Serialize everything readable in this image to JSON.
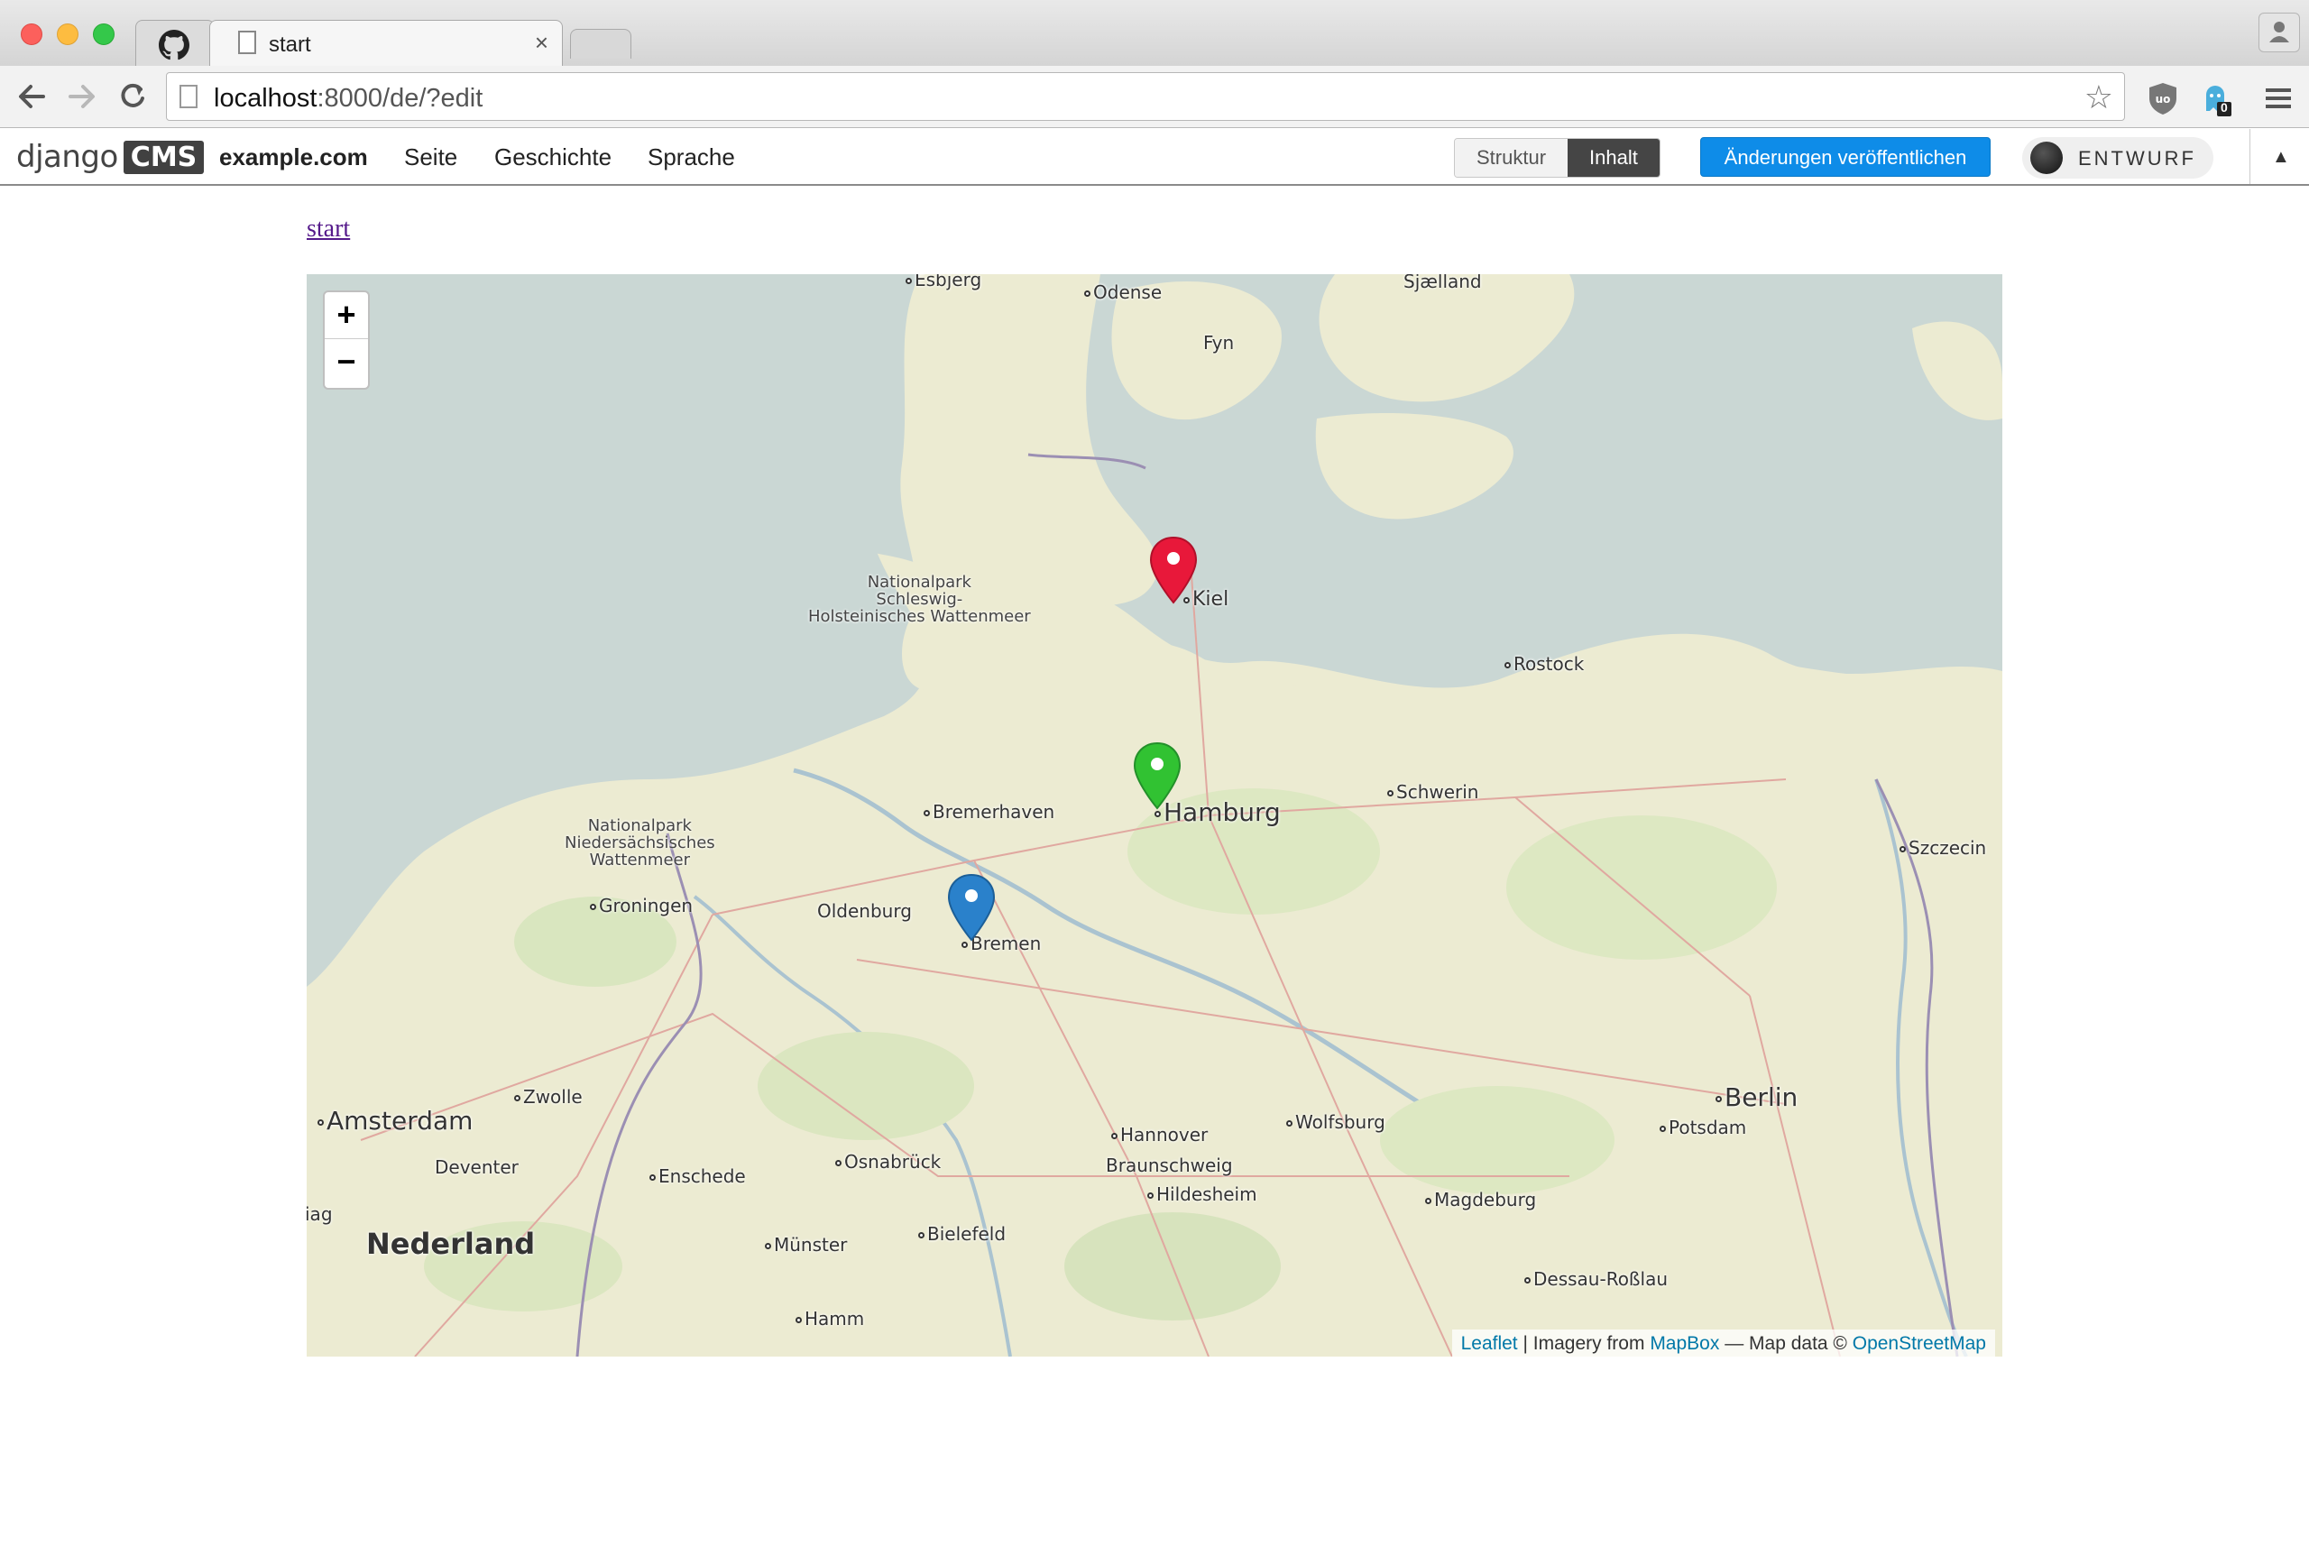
{
  "browser": {
    "tabs": [
      {
        "title": "",
        "icon": "github-icon"
      },
      {
        "title": "start",
        "icon": "document-icon",
        "active": true
      }
    ],
    "url": {
      "host": "localhost",
      "rest": ":8000/de/?edit"
    },
    "extensions": [
      "ublock-icon",
      "ghostery-icon"
    ],
    "ghostery_count": "0"
  },
  "cms": {
    "logo": {
      "django": "django",
      "cms": "CMS"
    },
    "menu": {
      "site": "example.com",
      "page": "Seite",
      "history": "Geschichte",
      "language": "Sprache"
    },
    "mode": {
      "structure": "Struktur",
      "content": "Inhalt",
      "active": "content"
    },
    "publish": "Änderungen veröffentlichen",
    "draft": "ENTWURF"
  },
  "page": {
    "link": "start"
  },
  "map": {
    "zoom_in": "+",
    "zoom_out": "−",
    "places": {
      "esbjerg": "Esbjerg",
      "odense": "Odense",
      "fyn": "Fyn",
      "sjaelland": "Sjælland",
      "np_sh_1": "Nationalpark",
      "np_sh_2": "Schleswig-",
      "np_sh_3": "Holsteinisches Wattenmeer",
      "kiel": "Kiel",
      "rostock": "Rostock",
      "schwerin": "Schwerin",
      "hamburg": "Hamburg",
      "bremerhaven": "Bremerhaven",
      "np_ns_1": "Nationalpark",
      "np_ns_2": "Niedersächsisches",
      "np_ns_3": "Wattenmeer",
      "szczecin": "Szczecin",
      "groningen": "Groningen",
      "oldenburg": "Oldenburg",
      "bremen": "Bremen",
      "zwolle": "Zwolle",
      "amsterdam": "Amsterdam",
      "deventer": "Deventer",
      "enschede": "Enschede",
      "osnabrueck": "Osnabrück",
      "hannover": "Hannover",
      "braunschweig": "Braunschweig",
      "wolfsburg": "Wolfsburg",
      "berlin": "Berlin",
      "potsdam": "Potsdam",
      "hildesheim": "Hildesheim",
      "magdeburg": "Magdeburg",
      "nederland": "Nederland",
      "haag": "iag",
      "bielefeld": "Bielefeld",
      "muenster": "Münster",
      "dessau": "Dessau-Roßlau",
      "hamm": "Hamm"
    },
    "markers": [
      {
        "name": "Kiel",
        "color": "#e8183a"
      },
      {
        "name": "Hamburg",
        "color": "#31c232"
      },
      {
        "name": "Bremen",
        "color": "#2a81cb"
      }
    ],
    "attribution": {
      "leaflet": "Leaflet",
      "sep1": " | Imagery from ",
      "mapbox": "MapBox",
      "sep2": " — Map data © ",
      "osm": "OpenStreetMap"
    }
  }
}
